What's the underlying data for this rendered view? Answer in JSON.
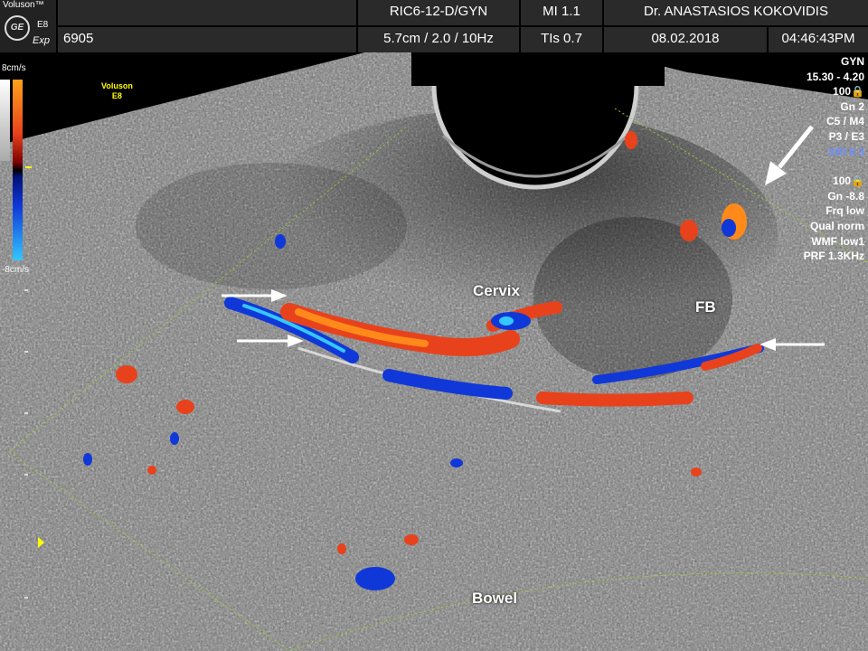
{
  "header": {
    "brand": "Voluson™",
    "logo_text": "GE",
    "model": "E8",
    "mode": "Exp",
    "patient_id": "6905",
    "probe": "RIC6-12-D/GYN",
    "mi": "MI  1.1",
    "physician": "Dr. ANASTASIOS KOKOVIDIS",
    "depth_info": "5.7cm / 2.0 / 10Hz",
    "tis": "TIs  0.7",
    "date": "08.02.2018",
    "time": "04:46:43PM"
  },
  "color_scale": {
    "top": "8cm/s",
    "bottom": "-8cm/s"
  },
  "small_logo": {
    "line1": "Voluson",
    "line2": "E8"
  },
  "settings": {
    "preset": "GYN",
    "freq_range": "15.30 - 4.20",
    "power": "100🔒",
    "gain": "Gn  2",
    "c_m": "C5 / M4",
    "p_e": "P3 / E3",
    "sri": "SRI II 3",
    "cf_power": "100🔒",
    "cf_gain": "Gn -8.8",
    "frq": "Frq low",
    "qual": "Qual norm",
    "wmf": "WMF low1",
    "prf": "PRF  1.3KHz"
  },
  "annotations": {
    "cervix": "Cervix",
    "fb": "FB",
    "bowel": "Bowel"
  },
  "colors": {
    "doppler_red": "#e8421c",
    "doppler_orange": "#ff8a1a",
    "doppler_blue": "#1038d8",
    "doppler_cyan": "#33c8ff",
    "roi_outline": "#9acd32",
    "header_bg": "#2a2a2a"
  }
}
